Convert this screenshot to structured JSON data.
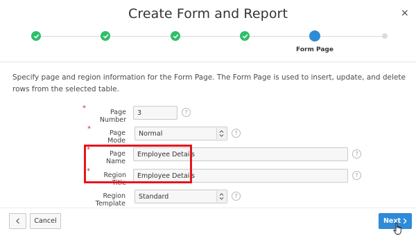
{
  "dialog": {
    "title": "Create Form and Report",
    "close_glyph": "×"
  },
  "wizard": {
    "current_step_label": "Form Page",
    "completed_steps": 4,
    "total_steps": 6
  },
  "intro": "Specify page and region information for the Form Page. The Form Page is used to insert, update, and delete rows from the selected table.",
  "form": {
    "page_number": {
      "label": "Page Number",
      "value": "3",
      "required": true
    },
    "page_mode": {
      "label": "Page Mode",
      "value": "Normal",
      "required": true
    },
    "page_name": {
      "label": "Page Name",
      "value": "Employee Details",
      "required": true
    },
    "region_title": {
      "label": "Region Title",
      "value": "Employee Details",
      "required": true
    },
    "region_template": {
      "label": "Region Template",
      "value": "Standard",
      "required": false
    },
    "required_marker": "*",
    "help_glyph": "?"
  },
  "buttons": {
    "cancel": "Cancel",
    "next": "Next"
  },
  "colors": {
    "accent": "#2e8bd8",
    "done": "#2ebf6a",
    "required": "#d0271d",
    "highlight": "#e5141b"
  },
  "icons": {
    "check": "check-icon",
    "back": "chevron-left-icon",
    "next": "chevron-right-icon",
    "help": "help-icon",
    "close": "close-icon",
    "cursor": "hand-pointer-icon"
  }
}
